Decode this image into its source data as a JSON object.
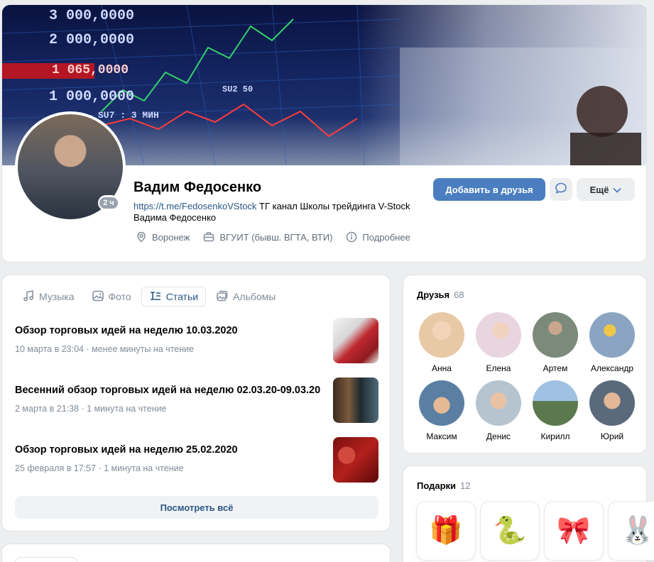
{
  "profile": {
    "name": "Вадим Федосенко",
    "status_link": "https://t.me/FedosenkoVStock",
    "status_text": " ТГ канал Школы трейдинга V-Stock Вадима Федосенко",
    "avatar_badge": "2 ч",
    "city": "Воронеж",
    "education": "ВГУИТ (бывш. ВГТА, ВТИ)",
    "more_info": "Подробнее",
    "add_friend_label": "Добавить в друзья",
    "more_label": "Ещё"
  },
  "cover": {
    "tickers": [
      "3 000,0000",
      "2 000,0000",
      "1 065,0000",
      "1 000,0000",
      "SU7 : 3 МИН",
      "SU2 50"
    ]
  },
  "tabs": [
    {
      "label": "Музыка",
      "icon": "music-icon"
    },
    {
      "label": "Фото",
      "icon": "photo-icon"
    },
    {
      "label": "Статьи",
      "icon": "article-icon",
      "active": true
    },
    {
      "label": "Альбомы",
      "icon": "albums-icon"
    }
  ],
  "articles": [
    {
      "title": "Обзор торговых идей на неделю 10.03.2020",
      "meta": "10 марта в 23:04 · менее минуты на чтение"
    },
    {
      "title": "Весенний обзор торговых идей на неделю 02.03.20-09.03.20",
      "meta": "2 марта в 21:38 · 1 минута на чтение"
    },
    {
      "title": "Обзор торговых идей на неделю 25.02.2020",
      "meta": "25 февраля в 17:57 · 1 минута на чтение"
    }
  ],
  "view_all_label": "Посмотреть всё",
  "friends": {
    "title": "Друзья",
    "count": "68",
    "list": [
      {
        "name": "Анна",
        "color": "#e8c9a6"
      },
      {
        "name": "Елена",
        "color": "#e9d5df"
      },
      {
        "name": "Артем",
        "color": "#7b8a7a"
      },
      {
        "name": "Александр",
        "color": "#8aa4c2"
      },
      {
        "name": "Максим",
        "color": "#5b7fa3"
      },
      {
        "name": "Денис",
        "color": "#b6c4cf"
      },
      {
        "name": "Кирилл",
        "color": "#6a8fb6"
      },
      {
        "name": "Юрий",
        "color": "#5a6a7c"
      }
    ]
  },
  "gifts": {
    "title": "Подарки",
    "count": "12",
    "items": [
      "🎁",
      "🐍",
      "🎀",
      "🐰"
    ]
  },
  "colors": {
    "accent": "#4a7ec0",
    "link": "#2a5885",
    "muted": "#818c99"
  }
}
